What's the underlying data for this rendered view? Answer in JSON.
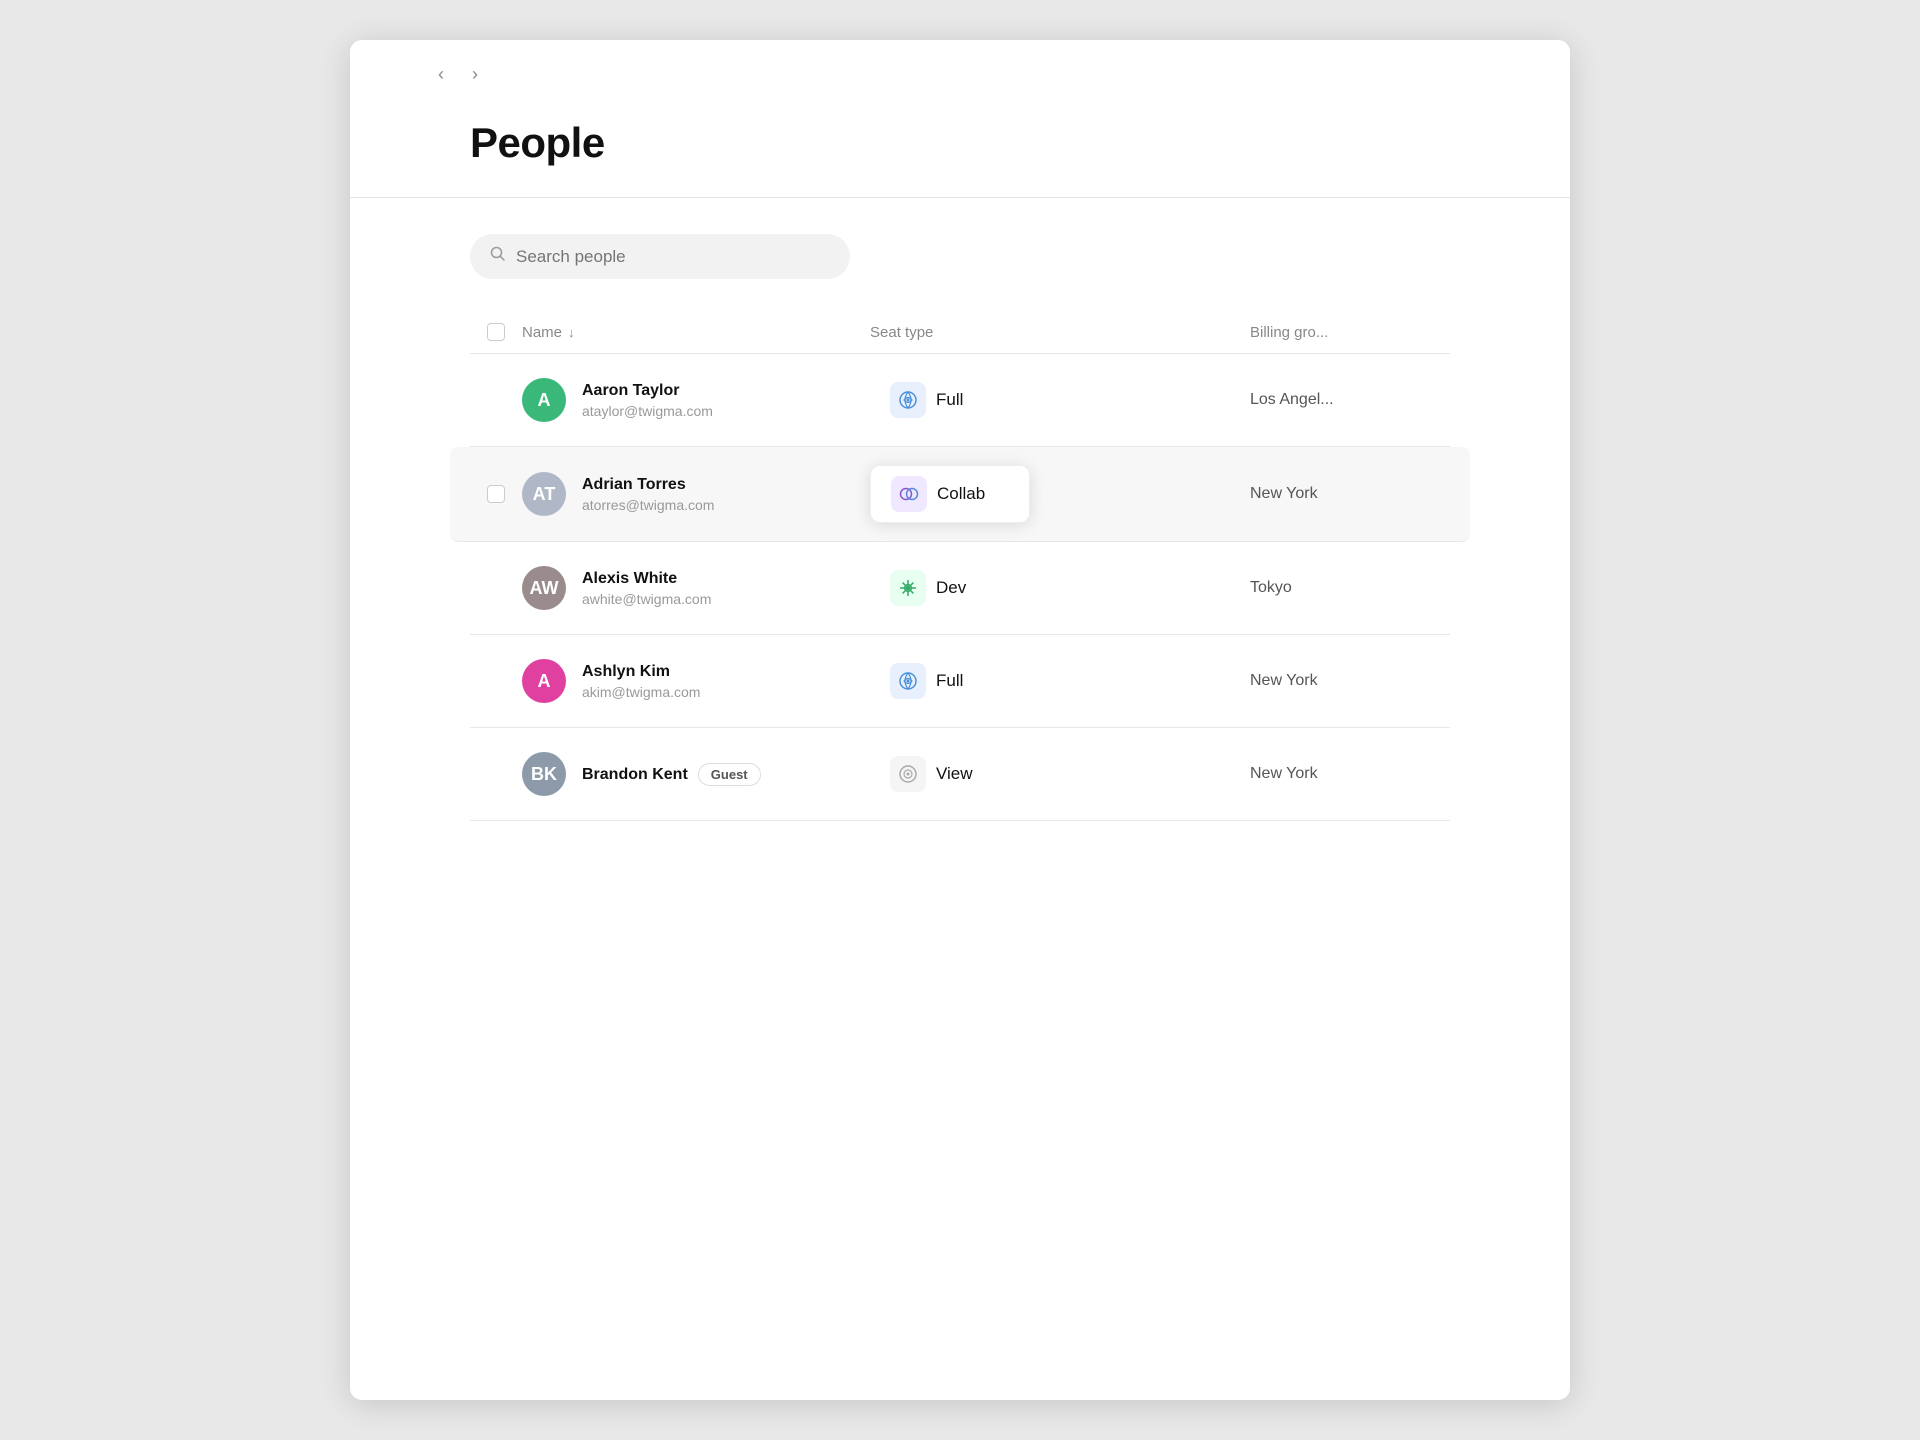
{
  "page": {
    "title": "People",
    "nav": {
      "back_label": "‹",
      "forward_label": "›"
    }
  },
  "search": {
    "placeholder": "Search people"
  },
  "table": {
    "headers": {
      "name": "Name",
      "seat_type": "Seat type",
      "billing_group": "Billing gro..."
    },
    "rows": [
      {
        "id": 1,
        "name": "Aaron Taylor",
        "email": "ataylor@twigma.com",
        "avatar_letter": "A",
        "avatar_color": "av-green",
        "avatar_type": "letter",
        "seat_type": "Full",
        "seat_icon_type": "full",
        "billing_group": "Los Angel...",
        "guest": false,
        "highlighted": false
      },
      {
        "id": 2,
        "name": "Adrian Torres",
        "email": "atorres@twigma.com",
        "avatar_letter": "",
        "avatar_color": "",
        "avatar_type": "photo",
        "seat_type": "Collab",
        "seat_icon_type": "collab",
        "billing_group": "New York",
        "guest": false,
        "highlighted": true
      },
      {
        "id": 3,
        "name": "Alexis White",
        "email": "awhite@twigma.com",
        "avatar_letter": "",
        "avatar_color": "",
        "avatar_type": "photo",
        "seat_type": "Dev",
        "seat_icon_type": "dev",
        "billing_group": "Tokyo",
        "guest": false,
        "highlighted": false
      },
      {
        "id": 4,
        "name": "Ashlyn Kim",
        "email": "akim@twigma.com",
        "avatar_letter": "A",
        "avatar_color": "av-pink",
        "avatar_type": "letter",
        "seat_type": "Full",
        "seat_icon_type": "full",
        "billing_group": "New York",
        "guest": false,
        "highlighted": false
      },
      {
        "id": 5,
        "name": "Brandon Kent",
        "email": "",
        "avatar_letter": "",
        "avatar_color": "",
        "avatar_type": "photo",
        "seat_type": "View",
        "seat_icon_type": "view",
        "billing_group": "New York",
        "guest": true,
        "highlighted": false
      }
    ]
  },
  "labels": {
    "guest": "Guest",
    "back": "‹",
    "forward": "›"
  }
}
